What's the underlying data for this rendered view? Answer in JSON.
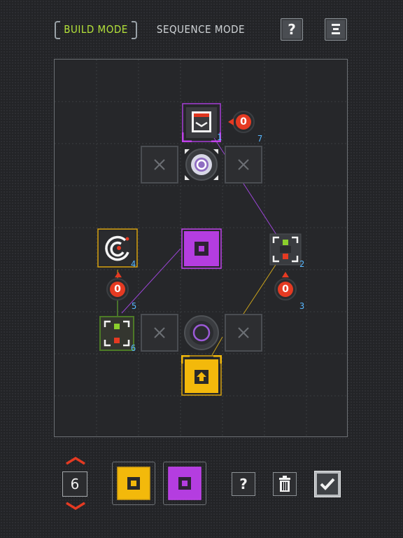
{
  "header": {
    "build_mode_label": "BUILD MODE",
    "sequence_mode_label": "SEQUENCE MODE",
    "help_label": "?",
    "menu_icon": "menu-icon"
  },
  "board": {
    "indices": {
      "n1": "1",
      "n2": "2",
      "n3": "3",
      "n4": "4",
      "n5": "5",
      "n6": "6",
      "n7": "7"
    },
    "counters": {
      "c7": "0",
      "c5": "0",
      "c3": "0"
    }
  },
  "footer": {
    "count_value": "6",
    "help_label": "?",
    "up_icon": "chevron-up-icon",
    "down_icon": "chevron-down-icon",
    "palette": [
      "yellow-block",
      "purple-block"
    ],
    "delete_icon": "trash-icon",
    "confirm_icon": "checkmark-icon"
  },
  "colors": {
    "build_active": "#b5e33a",
    "yellow": "#f3b90b",
    "purple": "#b43de0",
    "red": "#e53a22",
    "index_blue": "#58b7ff"
  }
}
